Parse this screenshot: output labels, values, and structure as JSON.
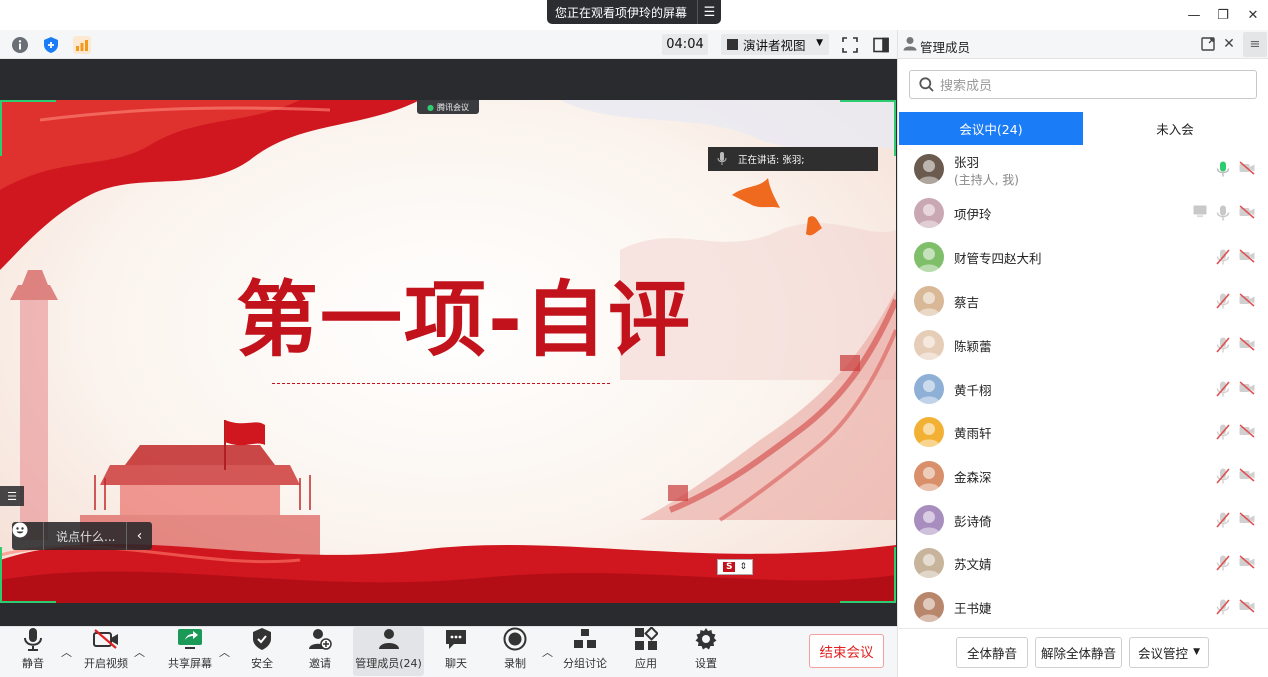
{
  "share_banner": {
    "text": "您正在观看项伊玲的屏幕",
    "menu_icon": "hamburger-icon"
  },
  "window_controls": {
    "minimize": "—",
    "restore": "❐",
    "close": "✕"
  },
  "infobar": {
    "timer": "04:04",
    "view_mode": "演讲者视图"
  },
  "slide": {
    "brand": "腾讯会议",
    "speaking": "正在讲话: 张羽;",
    "title": "第一项-自评",
    "page_label": "S"
  },
  "chat": {
    "placeholder": "说点什么..."
  },
  "toolbar": {
    "mute": "静音",
    "video": "开启视频",
    "share": "共享屏幕",
    "security": "安全",
    "invite": "邀请",
    "members": "管理成员(24)",
    "chat": "聊天",
    "record": "录制",
    "breakout": "分组讨论",
    "apps": "应用",
    "settings": "设置",
    "end_meeting": "结束会议"
  },
  "panel": {
    "title": "管理成员",
    "search_placeholder": "搜索成员",
    "tabs": [
      "会议中(24)",
      "未入会"
    ],
    "members": [
      {
        "name": "张羽",
        "sub": "(主持人, 我)",
        "mic": "on",
        "screen": false,
        "avatar": "#6b5b4f"
      },
      {
        "name": "项伊玲",
        "sub": "",
        "mic": "on-idle",
        "screen": true,
        "avatar": "#c9a7b3"
      },
      {
        "name": "财管专四赵大利",
        "sub": "",
        "mic": "muted",
        "screen": false,
        "avatar": "#7fbf6a"
      },
      {
        "name": "蔡吉",
        "sub": "",
        "mic": "muted",
        "screen": false,
        "avatar": "#d8b896"
      },
      {
        "name": "陈颖蕾",
        "sub": "",
        "mic": "muted",
        "screen": false,
        "avatar": "#e6cdb8"
      },
      {
        "name": "黄千栩",
        "sub": "",
        "mic": "muted",
        "screen": false,
        "avatar": "#8fb0d6"
      },
      {
        "name": "黄雨轩",
        "sub": "",
        "mic": "muted",
        "screen": false,
        "avatar": "#f2b134"
      },
      {
        "name": "金森深",
        "sub": "",
        "mic": "muted",
        "screen": false,
        "avatar": "#d98f6a"
      },
      {
        "name": "彭诗倚",
        "sub": "",
        "mic": "muted",
        "screen": false,
        "avatar": "#a88dbf"
      },
      {
        "name": "苏文婧",
        "sub": "",
        "mic": "muted",
        "screen": false,
        "avatar": "#c7b49b"
      },
      {
        "name": "王书婕",
        "sub": "",
        "mic": "muted",
        "screen": false,
        "avatar": "#b8866b"
      }
    ],
    "footer": {
      "mute_all": "全体静音",
      "unmute_all": "解除全体静音",
      "controls": "会议管控"
    }
  },
  "colors": {
    "accent": "#1a7cf7",
    "danger": "#e02020",
    "slide_red": "#c2121b",
    "frame_green": "#2ecc71"
  }
}
